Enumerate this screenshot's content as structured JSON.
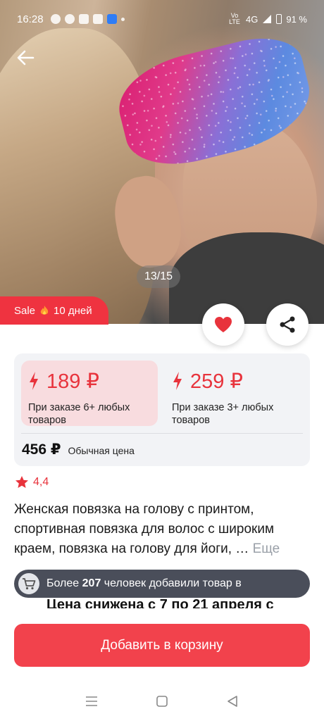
{
  "status_bar": {
    "time": "16:28",
    "network": "4G",
    "volte": "Vo LTE",
    "battery": "91 %"
  },
  "gallery": {
    "counter": "13/15"
  },
  "sale_badge": {
    "text": "Sale",
    "days": "10 дней"
  },
  "prices": {
    "tier1": {
      "amount": "189 ₽",
      "condition": "При заказе 6+ любых товаров"
    },
    "tier2": {
      "amount": "259 ₽",
      "condition": "При заказе 3+ любых товаров"
    },
    "regular": {
      "amount": "456 ₽",
      "label": "Обычная цена"
    }
  },
  "rating": {
    "value": "4,4"
  },
  "product": {
    "title": "Женская повязка на голову с принтом, спортивная повязка для волос с широким краем, повязка на голову для йоги, …",
    "more_label": "Еще"
  },
  "social_proof": {
    "prefix": "Более",
    "count": "207",
    "suffix": "человек добавили товар в"
  },
  "price_drop": {
    "text": "Цена снижена с 7 по 21 апреля с"
  },
  "cta": {
    "add_to_cart": "Добавить в корзину"
  },
  "colors": {
    "accent": "#ef3340",
    "button": "#f2424c",
    "tier_highlight": "#f8dcdf",
    "card_bg": "#f2f3f6",
    "banner": "#4a4e5a"
  },
  "icons": {
    "back": "arrow-left-icon",
    "favorite": "heart-icon",
    "share": "share-icon",
    "bolt": "lightning-icon",
    "star": "star-icon",
    "cart": "cart-icon",
    "fire": "fire-icon"
  }
}
